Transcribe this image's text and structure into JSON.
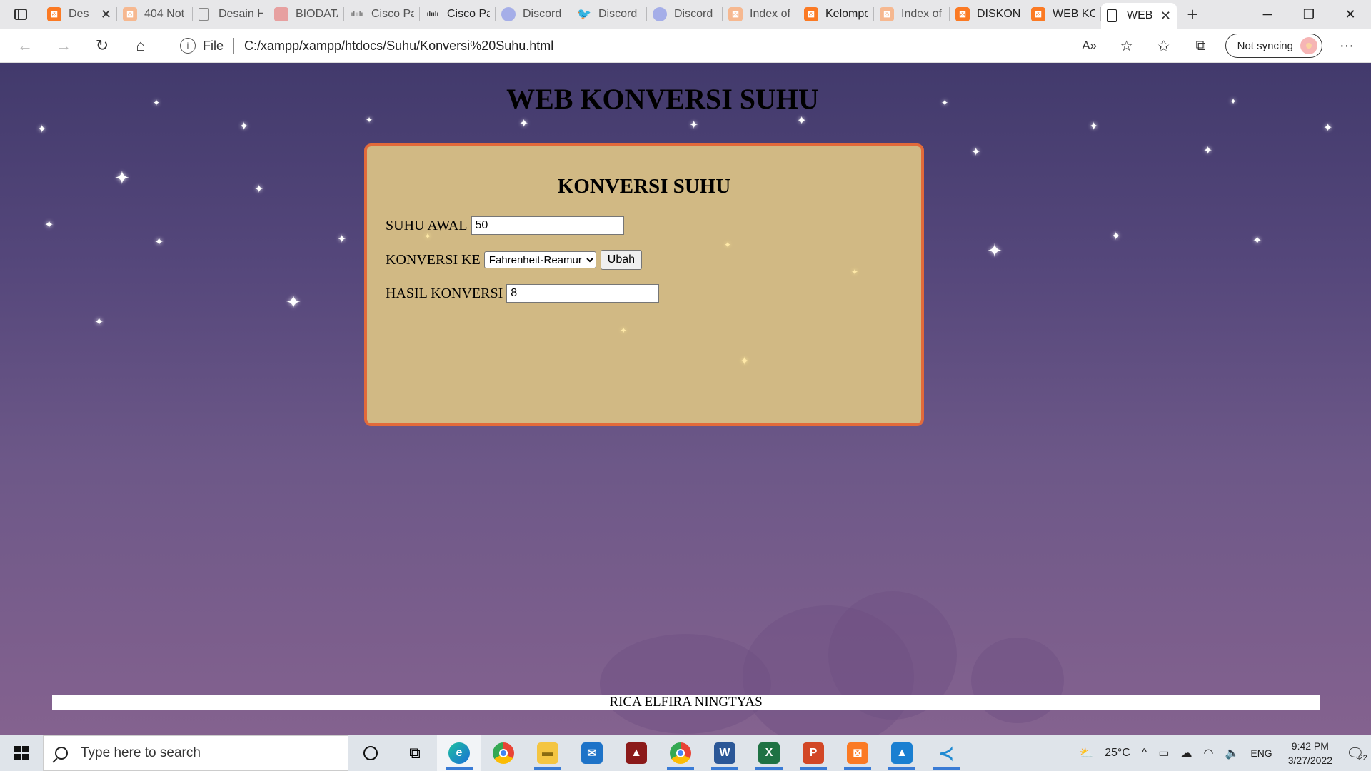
{
  "browser": {
    "tabs": [
      {
        "title": "Des",
        "icon": "xampp-icon"
      },
      {
        "title": "404 Not",
        "icon": "xampp-icon"
      },
      {
        "title": "Desain H",
        "icon": "page-icon"
      },
      {
        "title": "BIODATA",
        "icon": "pdf-icon"
      },
      {
        "title": "Cisco Pa",
        "icon": "cisco-icon"
      },
      {
        "title": "Cisco Pac",
        "icon": "cisco-icon"
      },
      {
        "title": "Discord |",
        "icon": "discord-icon"
      },
      {
        "title": "Discord (",
        "icon": "twitter-icon"
      },
      {
        "title": "Discord |",
        "icon": "discord-icon"
      },
      {
        "title": "Index of",
        "icon": "xampp-icon"
      },
      {
        "title": "Kelompo",
        "icon": "xampp-icon"
      },
      {
        "title": "Index of",
        "icon": "xampp-icon"
      },
      {
        "title": "DISKON",
        "icon": "xampp-icon"
      },
      {
        "title": "WEB KO",
        "icon": "xampp-icon"
      },
      {
        "title": "WEB",
        "icon": "page-icon",
        "active": true
      }
    ],
    "address": {
      "file_label": "File",
      "url": "C:/xampp/xampp/htdocs/Suhu/Konversi%20Suhu.html"
    },
    "sync_label": "Not syncing"
  },
  "page": {
    "title": "WEB KONVERSI SUHU",
    "card_title": "KONVERSI SUHU",
    "suhu_awal_label": "SUHU AWAL",
    "suhu_awal_value": "50",
    "konversi_ke_label": "KONVERSI KE",
    "konversi_selected": "Fahrenheit-Reamur",
    "ubah_label": "Ubah",
    "hasil_label": "HASIL KONVERSI",
    "hasil_value": "8",
    "footer": "RICA ELFIRA NINGTYAS"
  },
  "taskbar": {
    "search_placeholder": "Type here to search",
    "weather": "25°C",
    "language": "ENG",
    "time": "9:42 PM",
    "date": "3/27/2022",
    "notification_count": "22"
  },
  "colors": {
    "card_bg": "#d1b984",
    "card_border": "#e26a3a",
    "sky_top": "#423a6c",
    "sky_bottom": "#84628f"
  }
}
